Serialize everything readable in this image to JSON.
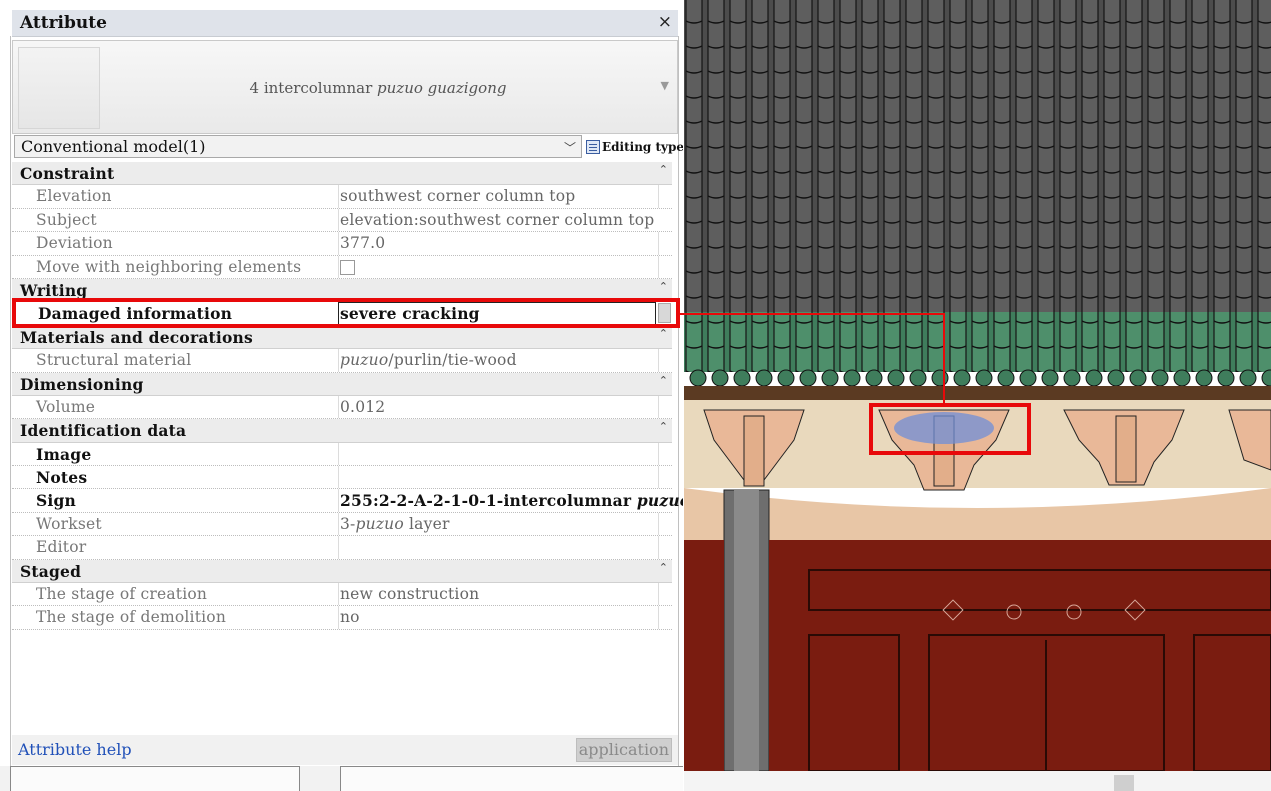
{
  "panel": {
    "title": "Attribute",
    "close_icon": "close-icon",
    "type_selector": {
      "prefix": "4 intercolumnar ",
      "italic": "puzuo guazigong"
    },
    "model_dropdown": "Conventional model(1)",
    "editing_type": "Editing type"
  },
  "properties": {
    "constraint": {
      "group": "Constraint",
      "elevation_label": "Elevation",
      "elevation_value": "southwest corner column top",
      "subject_label": "Subject",
      "subject_value": "elevation:southwest corner column top",
      "deviation_label": "Deviation",
      "deviation_value": "377.0",
      "move_label": "Move with neighboring elements",
      "move_checked": false
    },
    "writing": {
      "group": "Writing",
      "damaged_label": "Damaged information",
      "damaged_value": "severe cracking"
    },
    "materials": {
      "group": "Materials and decorations",
      "structural_label": "Structural material",
      "structural_italic": "puzuo",
      "structural_rest": "/purlin/tie-wood"
    },
    "dimensioning": {
      "group": "Dimensioning",
      "volume_label": "Volume",
      "volume_value": "0.012"
    },
    "identification": {
      "group": "Identification data",
      "image_label": "Image",
      "notes_label": "Notes",
      "sign_label": "Sign",
      "sign_prefix": "255:2-2-A-2-1-0-1-intercolumnar ",
      "sign_italic": "puzuo",
      "workset_label": "Workset",
      "workset_prefix": "3-",
      "workset_italic": "puzuo",
      "workset_rest": " layer",
      "editor_label": "Editor"
    },
    "staged": {
      "group": "Staged",
      "creation_label": "The stage of creation",
      "creation_value": "new construction",
      "demolition_label": "The stage of demolition",
      "demolition_value": "no"
    }
  },
  "footer": {
    "help": "Attribute help",
    "apply": "application"
  },
  "colors": {
    "highlight_red": "#e8090a",
    "roof_tile": "#4a4a4a",
    "eave_green": "#3f7d5c",
    "wall_red": "#7a1c10",
    "beam_beige": "#e9d9bd",
    "bracket_peach": "#e9b898",
    "selection_blue": "#6f8fd8"
  }
}
